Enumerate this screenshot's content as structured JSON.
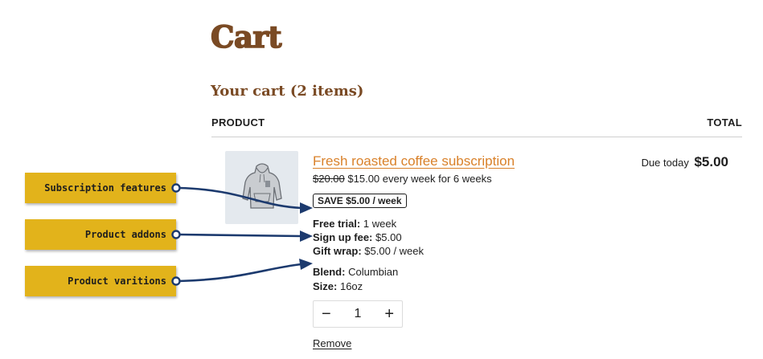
{
  "page": {
    "title": "Cart"
  },
  "cart": {
    "heading": "Your cart (2 items)",
    "columns": {
      "product": "PRODUCT",
      "total": "TOTAL"
    },
    "item": {
      "name": "Fresh roasted coffee subscription",
      "old_price": "$20.00",
      "price_text": "$15.00 every week for 6 weeks",
      "save_badge": "SAVE $5.00 / week",
      "meta": [
        {
          "label": "Free trial:",
          "value": "1 week"
        },
        {
          "label": "Sign up fee:",
          "value": "$5.00"
        },
        {
          "label": "Gift wrap:",
          "value": "$5.00 / week"
        },
        {
          "label": "Blend:",
          "value": "Columbian"
        },
        {
          "label": "Size:",
          "value": "16oz"
        }
      ],
      "quantity": "1",
      "decrement": "−",
      "increment": "+",
      "remove": "Remove",
      "due_label": "Due today",
      "due_amount": "$5.00",
      "image_icon": "hoodie-icon"
    }
  },
  "annotations": [
    {
      "label": "Subscription features"
    },
    {
      "label": "Product addons"
    },
    {
      "label": "Product varitions"
    }
  ],
  "colors": {
    "heading": "#7a4a24",
    "link": "#d9812a",
    "callout_bg": "#e2b31b",
    "arrow": "#1c3a6e",
    "thumb_bg": "#e4e9ee"
  }
}
